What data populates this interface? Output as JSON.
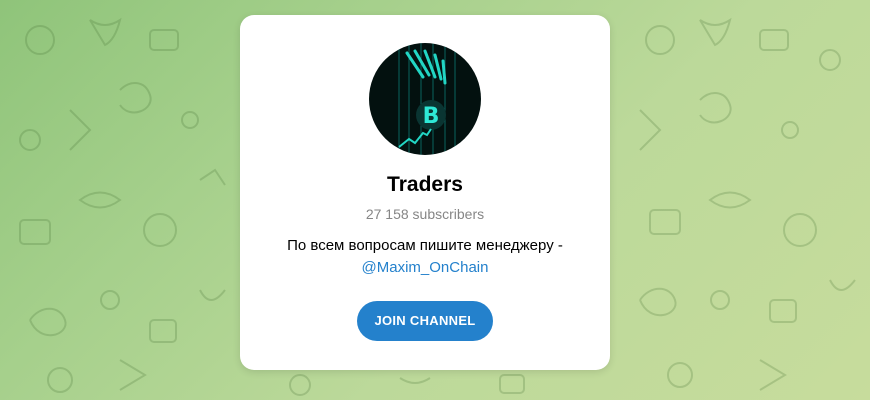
{
  "channel": {
    "title": "Traders",
    "subscribers": "27 158 subscribers",
    "description": "По всем вопросам пишите менеджеру -",
    "link": "@Maxim_OnChain",
    "avatar_symbol": "B"
  },
  "actions": {
    "join_label": "JOIN CHANNEL"
  },
  "colors": {
    "accent": "#2481cc",
    "background": "#a6d08c",
    "card": "#ffffff",
    "muted_text": "#868686"
  }
}
